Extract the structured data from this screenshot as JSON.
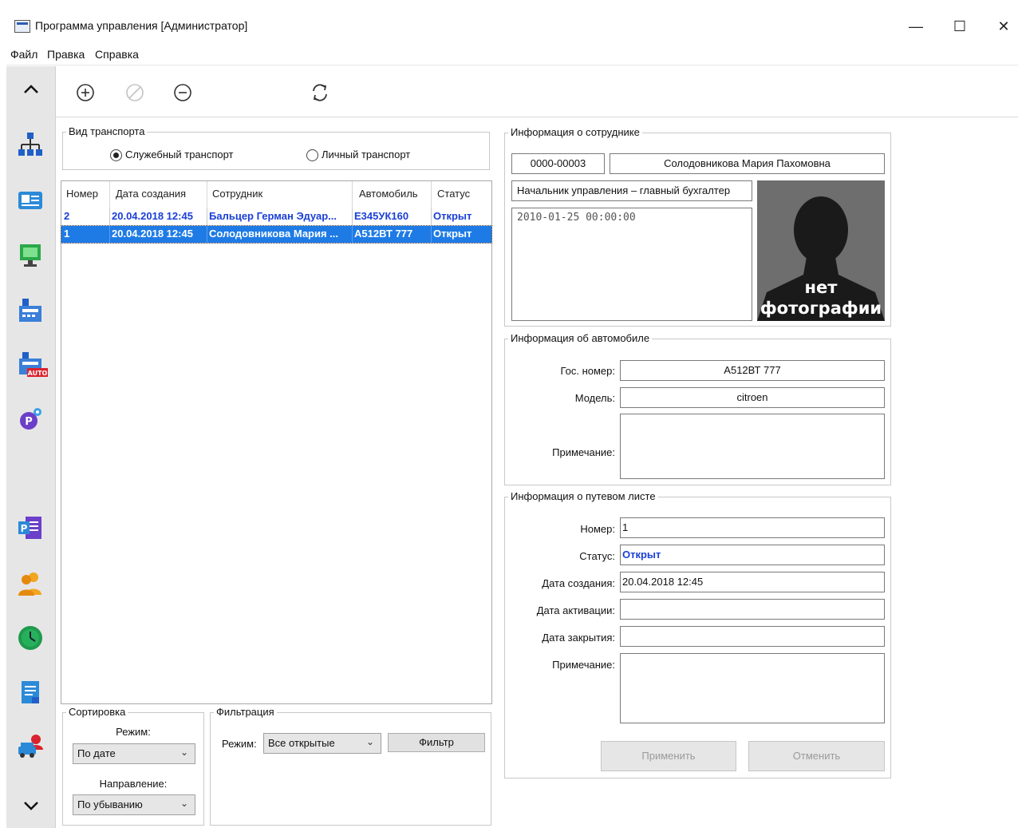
{
  "window": {
    "title": "Программа управления [Администратор]",
    "minimize": "—",
    "maximize": "☐",
    "close": "✕"
  },
  "menu": [
    "Файл",
    "Правка",
    "Справка"
  ],
  "sidebar": {
    "up": "⌃",
    "down": "⌄",
    "icons": [
      "org-structure-icon",
      "id-card-icon",
      "monitor-icon",
      "terminal-icon",
      "terminal-auto-icon",
      "parking-settings-icon",
      "parking-report-icon",
      "users-icon",
      "clock-icon",
      "document-icon",
      "vehicle-user-icon"
    ],
    "auto_badge": "AUTO"
  },
  "transport_type": {
    "title": "Вид транспорта",
    "options": [
      {
        "label": "Служебный транспорт",
        "checked": true
      },
      {
        "label": "Личный транспорт",
        "checked": false
      }
    ]
  },
  "table": {
    "columns": [
      "Номер",
      "Дата создания",
      "Сотрудник",
      "Автомобиль",
      "Статус"
    ],
    "rows": [
      {
        "num": "2",
        "date": "20.04.2018 12:45",
        "employee": "Бальцер Герман Эдуар...",
        "car": "Е345УК160",
        "status": "Открыт",
        "selected": false
      },
      {
        "num": "1",
        "date": "20.04.2018 12:45",
        "employee": "Солодовникова Мария ...",
        "car": "А512ВТ 777",
        "status": "Открыт",
        "selected": true
      }
    ]
  },
  "sort": {
    "title": "Сортировка",
    "mode_label": "Режим:",
    "mode_value": "По дате",
    "direction_label": "Направление:",
    "direction_value": "По убыванию"
  },
  "filter": {
    "title": "Фильтрация",
    "mode_label": "Режим:",
    "mode_value": "Все открытые",
    "button": "Фильтр"
  },
  "employee": {
    "title": "Информация о сотруднике",
    "id": "0000-00003",
    "name": "Солодовникова Мария Пахомовна",
    "position": "Начальник управления – главный бухгалтер",
    "note": "2010-01-25 00:00:00",
    "photo_line1": "нет",
    "photo_line2": "фотографии"
  },
  "car": {
    "title": "Информация об автомобиле",
    "plate_label": "Гос. номер:",
    "plate": "А512ВТ 777",
    "model_label": "Модель:",
    "model": "citroen",
    "note_label": "Примечание:",
    "note": ""
  },
  "waybill": {
    "title": "Информация о путевом листе",
    "number_label": "Номер:",
    "number": "1",
    "status_label": "Статус:",
    "status": "Открыт",
    "created_label": "Дата создания:",
    "created": "20.04.2018 12:45",
    "activated_label": "Дата активации:",
    "activated": "",
    "closed_label": "Дата закрытия:",
    "closed": "",
    "note_label": "Примечание:",
    "note": "",
    "apply": "Применить",
    "cancel": "Отменить"
  },
  "colors": {
    "accent": "#1a3fd6",
    "selection": "#1e7be6"
  }
}
